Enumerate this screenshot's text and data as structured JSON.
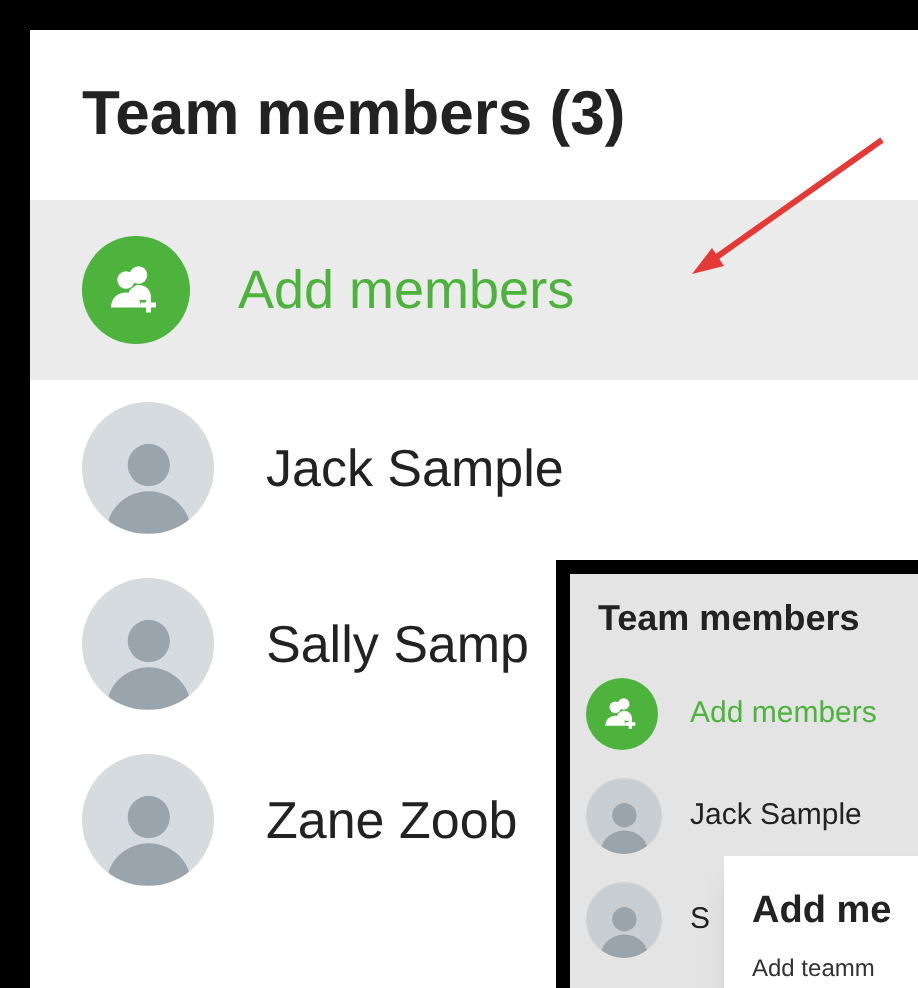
{
  "main": {
    "title": "Team members (3)",
    "add_label": "Add members",
    "members": [
      {
        "name": "Jack Sample"
      },
      {
        "name": "Sally Samp"
      },
      {
        "name": "Zane Zoob"
      }
    ]
  },
  "inset": {
    "title": "Team members",
    "add_label": "Add members",
    "members": [
      {
        "name": "Jack Sample"
      },
      {
        "name": "S"
      }
    ],
    "dialog": {
      "title": "Add me",
      "text": "Add teamm"
    }
  }
}
